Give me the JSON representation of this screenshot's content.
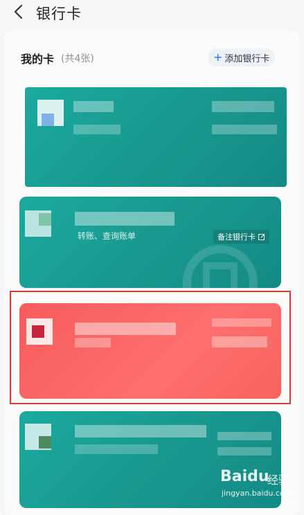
{
  "header": {
    "title": "银行卡"
  },
  "section": {
    "title": "我的卡",
    "count": "(共4张)",
    "add_button_label": "添加银行卡"
  },
  "cards": [
    {
      "style": "teal"
    },
    {
      "style": "teal",
      "subtitle": "转账、查询账单",
      "note_label": "备注银行卡"
    },
    {
      "style": "red",
      "highlighted": true
    },
    {
      "style": "teal"
    }
  ],
  "watermark": {
    "brand": "Baidu",
    "brand_cn": "经验",
    "url": "jingyan.baidu.com"
  },
  "colors": {
    "teal": "#1ba99f",
    "red": "#ff6464",
    "highlight": "#c9403b",
    "accent": "#1f6fff"
  }
}
